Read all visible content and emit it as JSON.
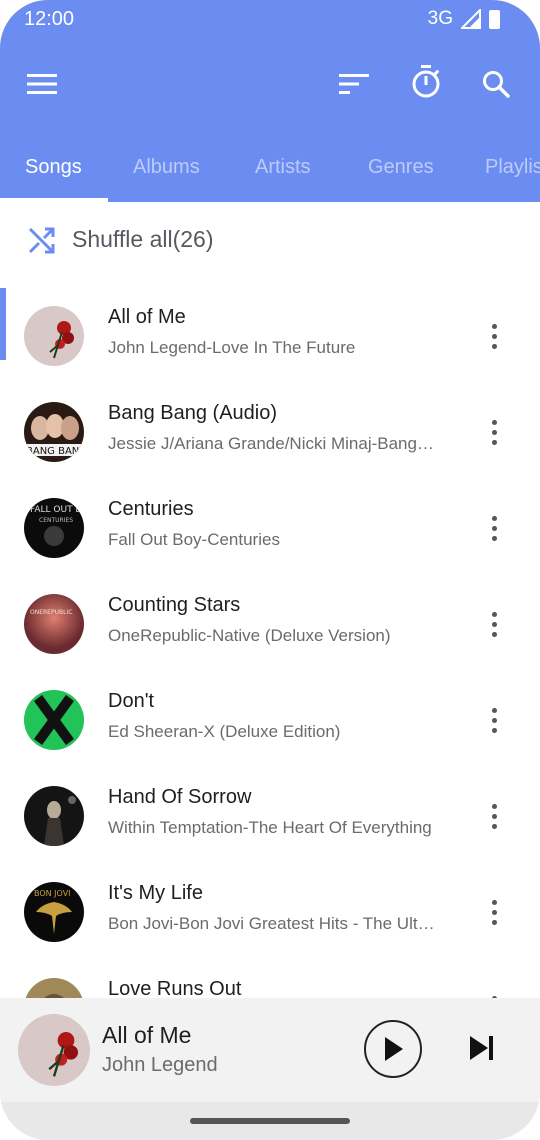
{
  "status_bar": {
    "time": "12:00",
    "network": "3G"
  },
  "toolbar": {
    "icons": [
      "menu-icon",
      "sort-icon",
      "timer-icon",
      "search-icon"
    ]
  },
  "tabs": [
    {
      "label": "Songs",
      "active": true
    },
    {
      "label": "Albums",
      "active": false
    },
    {
      "label": "Artists",
      "active": false
    },
    {
      "label": "Genres",
      "active": false
    },
    {
      "label": "Playlis",
      "active": false
    }
  ],
  "shuffle": {
    "label": "Shuffle all(26)"
  },
  "songs": [
    {
      "title": "All of Me",
      "subtitle": "John Legend-Love In The Future",
      "active": true
    },
    {
      "title": "Bang Bang (Audio)",
      "subtitle": "Jessie J/Ariana Grande/Nicki Minaj-Bang Bang",
      "active": false
    },
    {
      "title": "Centuries",
      "subtitle": "Fall Out Boy-Centuries",
      "active": false
    },
    {
      "title": "Counting Stars",
      "subtitle": "OneRepublic-Native (Deluxe Version)",
      "active": false
    },
    {
      "title": "Don't",
      "subtitle": "Ed Sheeran-X (Deluxe Edition)",
      "active": false
    },
    {
      "title": "Hand Of Sorrow",
      "subtitle": "Within Temptation-The Heart Of Everything",
      "active": false
    },
    {
      "title": "It's My Life",
      "subtitle": "Bon Jovi-Bon Jovi Greatest Hits - The Ultimate Collection",
      "active": false
    },
    {
      "title": "Love Runs Out",
      "subtitle": "",
      "active": false
    }
  ],
  "now_playing": {
    "title": "All of Me",
    "artist": "John Legend"
  },
  "colors": {
    "accent": "#6b8cf0"
  }
}
